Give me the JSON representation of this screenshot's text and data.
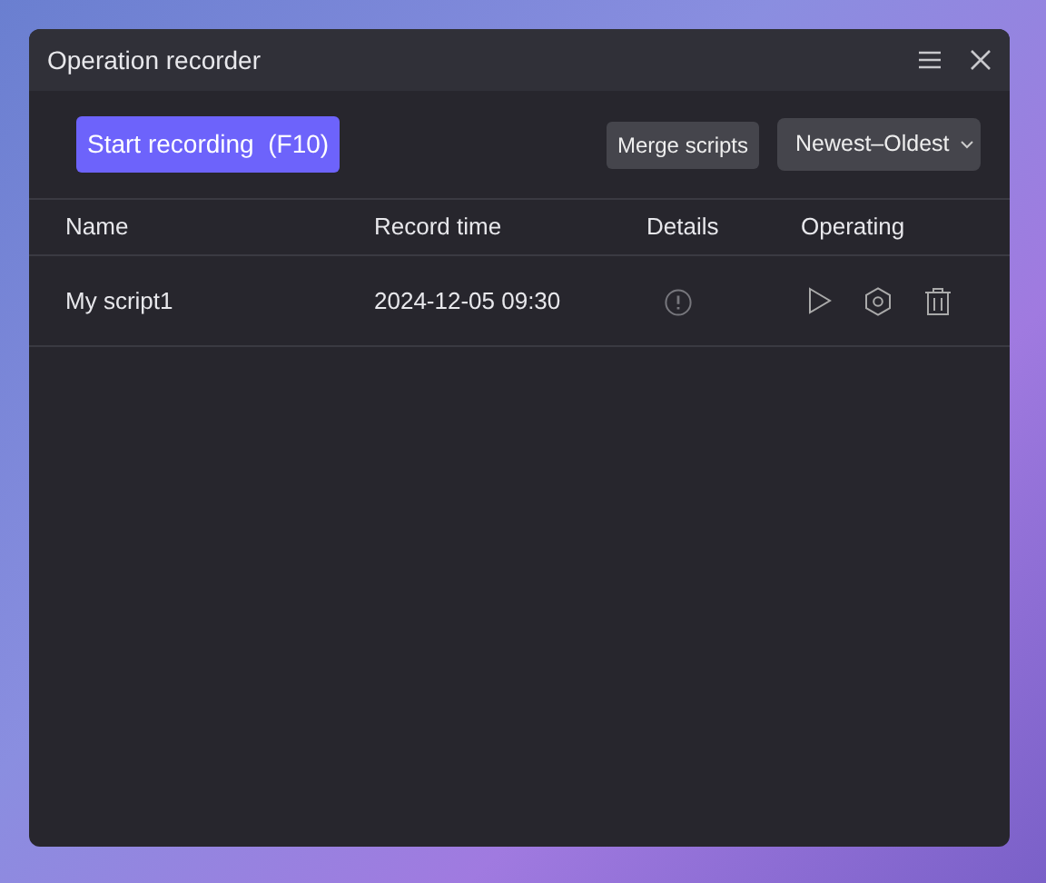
{
  "window": {
    "title": "Operation recorder"
  },
  "toolbar": {
    "record_button": "Start recording  (F10)",
    "merge_button": "Merge scripts",
    "sort_select": "Newest–Oldest"
  },
  "table": {
    "columns": [
      "Name",
      "Record time",
      "Details",
      "Operating"
    ],
    "rows": [
      {
        "name": "My script1",
        "record_time": "2024-12-05 09:30"
      }
    ]
  }
}
